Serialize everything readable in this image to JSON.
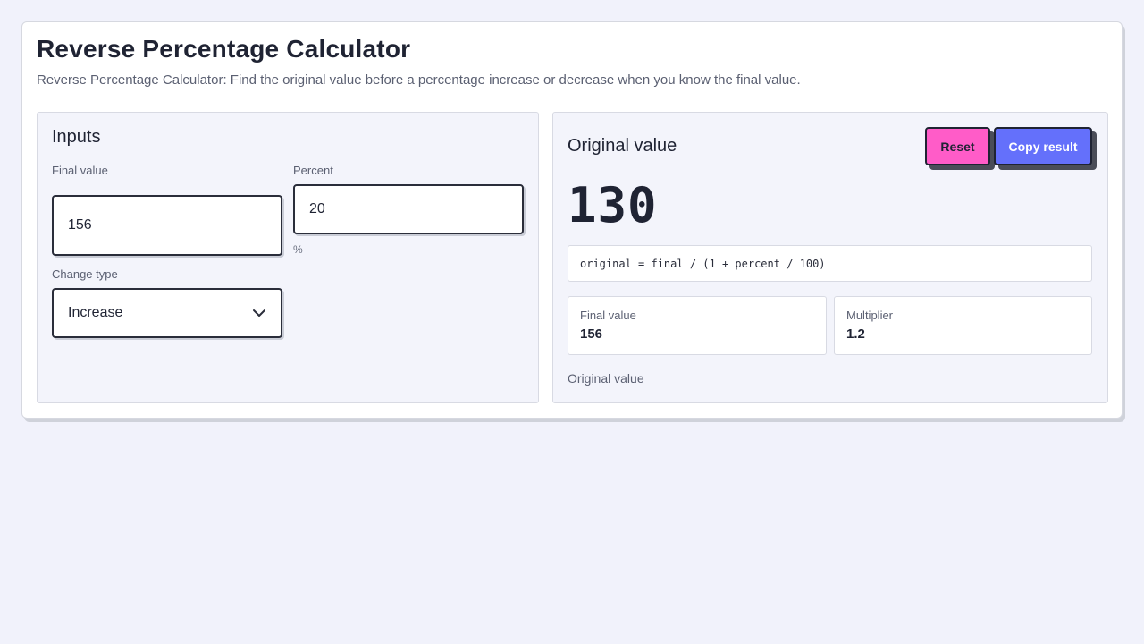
{
  "page": {
    "title": "Reverse Percentage Calculator",
    "subtitle": "Reverse Percentage Calculator: Find the original value before a percentage increase or decrease when you know the final value."
  },
  "inputs": {
    "heading": "Inputs",
    "final_value": {
      "label": "Final value",
      "value": "156"
    },
    "percent": {
      "label": "Percent",
      "value": "20",
      "unit": "%"
    },
    "change_type": {
      "label": "Change type",
      "selected": "Increase",
      "icon": "chevron-down-icon"
    }
  },
  "result": {
    "heading": "Original value",
    "value": "130",
    "formula": "original = final / (1 + percent / 100)",
    "stats": [
      {
        "label": "Final value",
        "value": "156"
      },
      {
        "label": "Multiplier",
        "value": "1.2"
      }
    ],
    "caption": "Original value",
    "buttons": {
      "reset": "Reset",
      "copy": "Copy result"
    }
  },
  "colors": {
    "background": "#f1f2fb",
    "reset_button": "#ff5cc8",
    "copy_button": "#6470fb",
    "text": "#1f2333"
  }
}
